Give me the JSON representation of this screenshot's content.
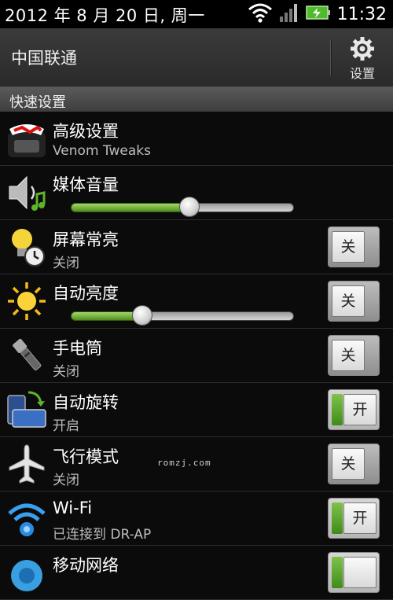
{
  "statusbar": {
    "date": "2012 年 8 月 20 日, 周一",
    "time": "11:32",
    "icons": [
      "wifi-icon",
      "signal-icon",
      "battery-charging-icon"
    ]
  },
  "header": {
    "carrier": "中国联通",
    "settings_label": "设置"
  },
  "section": {
    "title": "快速设置"
  },
  "rows": [
    {
      "title": "高级设置",
      "subtitle": "Venom Tweaks",
      "icon": "venom-icon"
    },
    {
      "title": "媒体音量",
      "icon": "speaker-icon",
      "slider_value": 0.53
    },
    {
      "title": "屏幕常亮",
      "subtitle": "关闭",
      "icon": "bulb-clock-icon",
      "toggle": "关",
      "state": "off"
    },
    {
      "title": "自动亮度",
      "icon": "sun-icon",
      "slider_value": 0.32,
      "toggle": "关",
      "state": "off"
    },
    {
      "title": "手电筒",
      "subtitle": "关闭",
      "icon": "flashlight-icon",
      "toggle": "关",
      "state": "off"
    },
    {
      "title": "自动旋转",
      "subtitle": "开启",
      "icon": "rotate-icon",
      "toggle": "开",
      "state": "on"
    },
    {
      "title": "飞行模式",
      "subtitle": "关闭",
      "icon": "airplane-icon",
      "toggle": "关",
      "state": "off"
    },
    {
      "title": "Wi-Fi",
      "subtitle": "已连接到 DR-AP",
      "icon": "wifi-icon",
      "toggle": "开",
      "state": "on"
    },
    {
      "title": "移动网络",
      "icon": "mobile-network-icon",
      "state": "on"
    }
  ],
  "watermark": "romzj.com",
  "colors": {
    "accent_green": "#5fa82b",
    "background": "#0b0b0b"
  }
}
